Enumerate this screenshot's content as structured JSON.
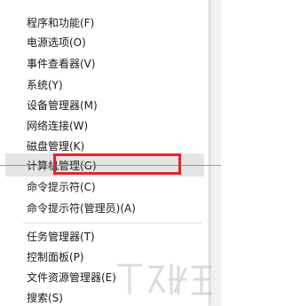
{
  "menu": {
    "items": [
      {
        "label": "程序和功能(F)"
      },
      {
        "label": "电源选项(O)"
      },
      {
        "label": "事件查看器(V)"
      },
      {
        "label": "系统(Y)"
      },
      {
        "label": "设备管理器(M)"
      },
      {
        "label": "网络连接(W)"
      },
      {
        "label": "磁盘管理(K)"
      },
      {
        "label": "计算机管理(G)"
      },
      {
        "label": "命令提示符(C)"
      },
      {
        "label": "命令提示符(管理员)(A)"
      },
      {
        "label": "任务管理器(T)"
      },
      {
        "label": "控制面板(P)"
      },
      {
        "label": "文件资源管理器(E)"
      },
      {
        "label": "搜索(S)"
      }
    ],
    "highlighted_item": "计算机管理(G)"
  },
  "annotation": {
    "box_color": "#e2262c"
  }
}
